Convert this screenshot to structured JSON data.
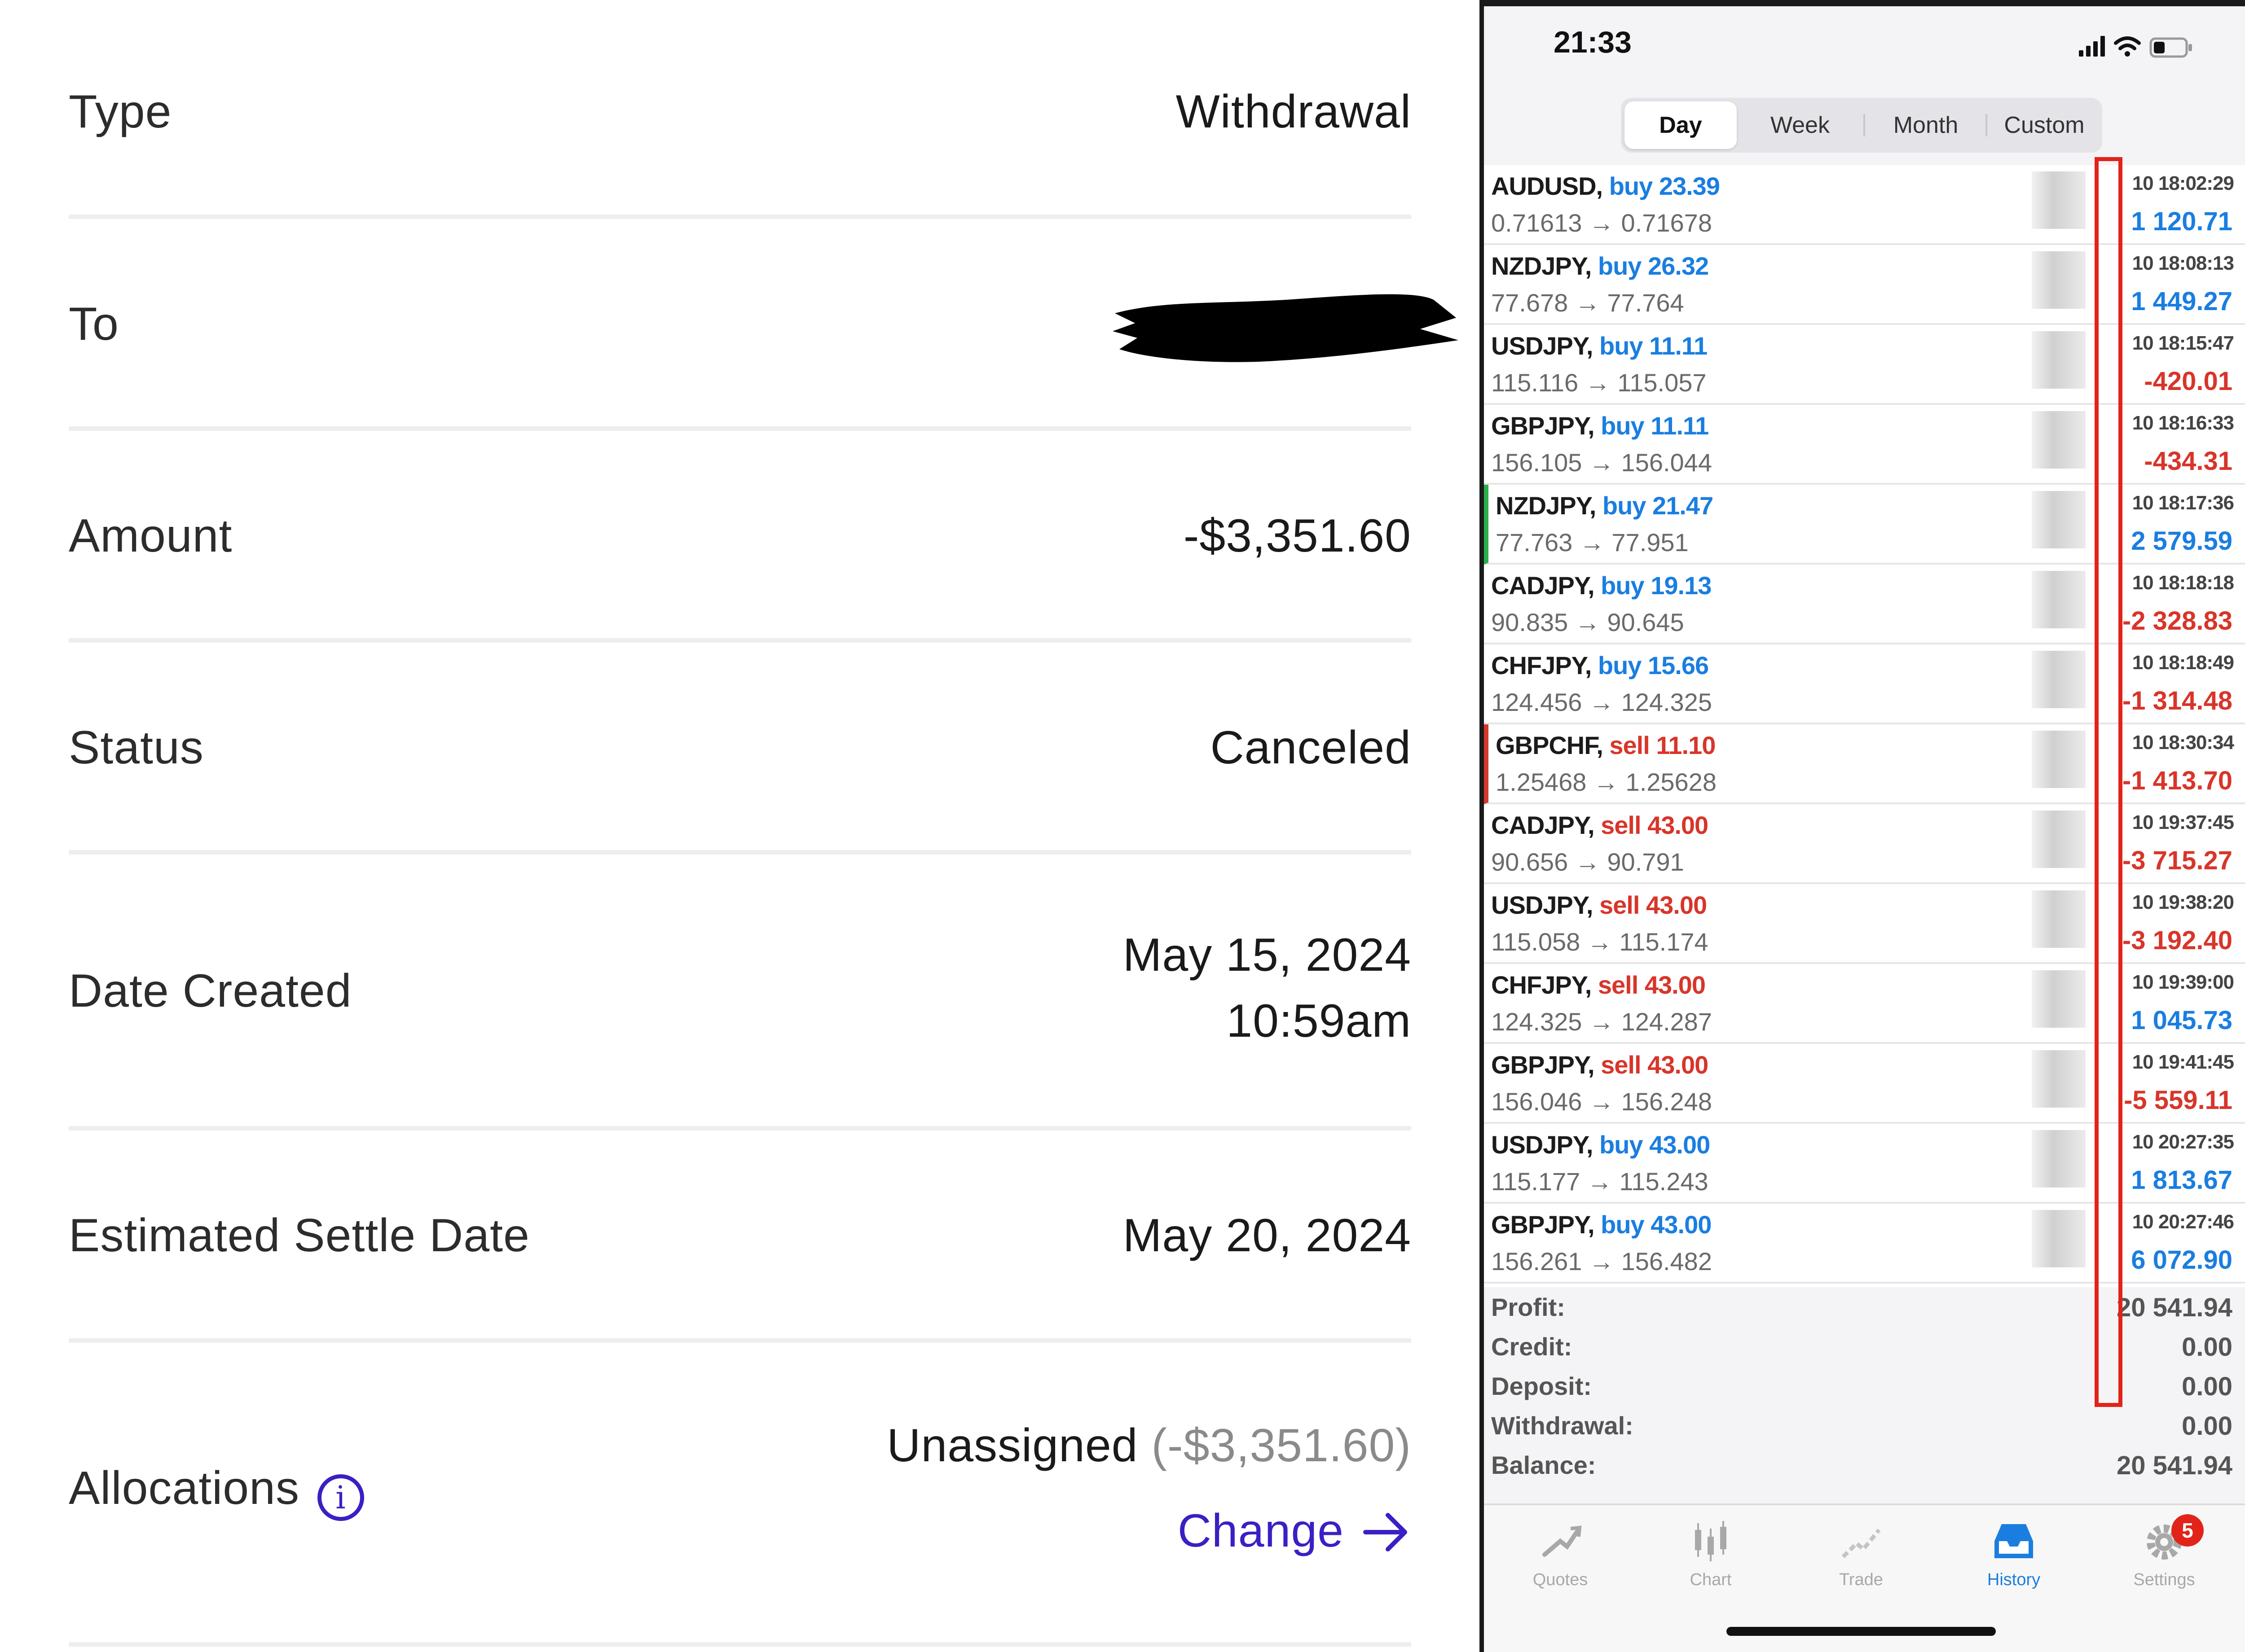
{
  "details": {
    "type": {
      "label": "Type",
      "value": "Withdrawal"
    },
    "to": {
      "label": "To"
    },
    "amount": {
      "label": "Amount",
      "value": "-$3,351.60"
    },
    "status": {
      "label": "Status",
      "value": "Canceled"
    },
    "date_created": {
      "label": "Date Created",
      "date": "May 15, 2024",
      "time": "10:59am"
    },
    "settle": {
      "label": "Estimated Settle Date",
      "value": "May 20, 2024"
    },
    "allocations": {
      "label": "Allocations",
      "value": "Unassigned",
      "amount": "(-$3,351.60)",
      "change": "Change"
    }
  },
  "phone": {
    "time": "21:33",
    "tabs": [
      "Day",
      "Week",
      "Month",
      "Custom"
    ],
    "active_tab": "Day",
    "trades": [
      {
        "symbol": "AUDUSD,",
        "side": "buy",
        "volume": "23.39",
        "prices": "0.71613 → 0.71678",
        "date": "10 18:02:29",
        "profit": "1 120.71"
      },
      {
        "symbol": "NZDJPY,",
        "side": "buy",
        "volume": "26.32",
        "prices": "77.678 → 77.764",
        "date": "10 18:08:13",
        "profit": "1 449.27"
      },
      {
        "symbol": "USDJPY,",
        "side": "buy",
        "volume": "11.11",
        "prices": "115.116 → 115.057",
        "date": "10 18:15:47",
        "profit": "-420.01"
      },
      {
        "symbol": "GBPJPY,",
        "side": "buy",
        "volume": "11.11",
        "prices": "156.105 → 156.044",
        "date": "10 18:16:33",
        "profit": "-434.31"
      },
      {
        "symbol": "NZDJPY,",
        "side": "buy",
        "volume": "21.47",
        "prices": "77.763 → 77.951",
        "date": "10 18:17:36",
        "profit": "2 579.59"
      },
      {
        "symbol": "CADJPY,",
        "side": "buy",
        "volume": "19.13",
        "prices": "90.835 → 90.645",
        "date": "10 18:18:18",
        "profit": "-2 328.83"
      },
      {
        "symbol": "CHFJPY,",
        "side": "buy",
        "volume": "15.66",
        "prices": "124.456 → 124.325",
        "date": "10 18:18:49",
        "profit": "-1 314.48"
      },
      {
        "symbol": "GBPCHF,",
        "side": "sell",
        "volume": "11.10",
        "prices": "1.25468 → 1.25628",
        "date": "10 18:30:34",
        "profit": "-1 413.70"
      },
      {
        "symbol": "CADJPY,",
        "side": "sell",
        "volume": "43.00",
        "prices": "90.656 → 90.791",
        "date": "10 19:37:45",
        "profit": "-3 715.27"
      },
      {
        "symbol": "USDJPY,",
        "side": "sell",
        "volume": "43.00",
        "prices": "115.058 → 115.174",
        "date": "10 19:38:20",
        "profit": "-3 192.40"
      },
      {
        "symbol": "CHFJPY,",
        "side": "sell",
        "volume": "43.00",
        "prices": "124.325 → 124.287",
        "date": "10 19:39:00",
        "profit": "1 045.73"
      },
      {
        "symbol": "GBPJPY,",
        "side": "sell",
        "volume": "43.00",
        "prices": "156.046 → 156.248",
        "date": "10 19:41:45",
        "profit": "-5 559.11"
      },
      {
        "symbol": "USDJPY,",
        "side": "buy",
        "volume": "43.00",
        "prices": "115.177 → 115.243",
        "date": "10 20:27:35",
        "profit": "1 813.67"
      },
      {
        "symbol": "GBPJPY,",
        "side": "buy",
        "volume": "43.00",
        "prices": "156.261 → 156.482",
        "date": "10 20:27:46",
        "profit": "6 072.90"
      }
    ],
    "summary": [
      {
        "label": "Profit:",
        "value": "20 541.94"
      },
      {
        "label": "Credit:",
        "value": "0.00"
      },
      {
        "label": "Deposit:",
        "value": "0.00"
      },
      {
        "label": "Withdrawal:",
        "value": "0.00"
      },
      {
        "label": "Balance:",
        "value": "20 541.94"
      }
    ],
    "nav": [
      {
        "label": "Quotes",
        "icon": "quotes-icon"
      },
      {
        "label": "Chart",
        "icon": "chart-icon"
      },
      {
        "label": "Trade",
        "icon": "trade-icon"
      },
      {
        "label": "History",
        "icon": "history-icon"
      },
      {
        "label": "Settings",
        "icon": "settings-icon",
        "badge": "5"
      }
    ],
    "active_nav": "History",
    "colors": {
      "buy": "#1a7ee0",
      "sell": "#d8352a",
      "highlight": "#e2231a",
      "accent": "#3b1fc4"
    }
  }
}
